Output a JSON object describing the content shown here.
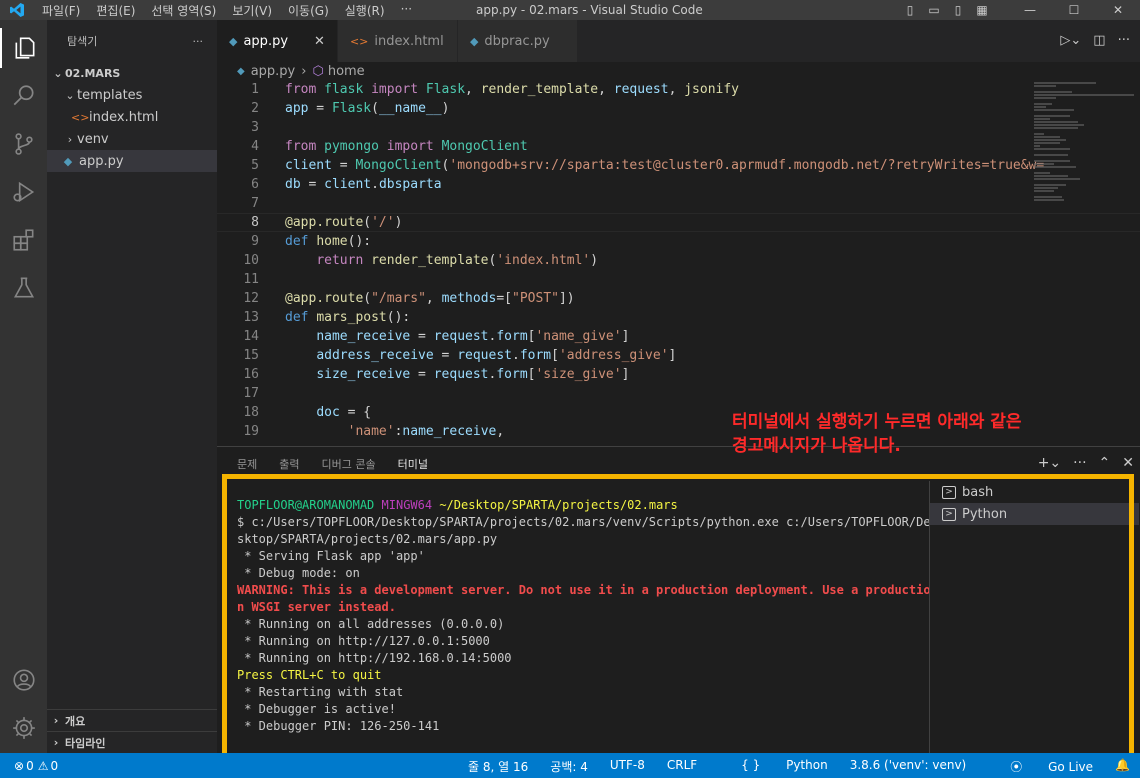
{
  "window": {
    "title": "app.py - 02.mars - Visual Studio Code",
    "menu": [
      "파일(F)",
      "편집(E)",
      "선택 영역(S)",
      "보기(V)",
      "이동(G)",
      "실행(R)",
      "···"
    ]
  },
  "sidebar": {
    "title": "탐색기",
    "more": "···",
    "root": "02.MARS",
    "items": [
      {
        "label": "templates",
        "icon": "chevron-down-icon"
      },
      {
        "label": "index.html",
        "icon": "html-file-icon"
      },
      {
        "label": "venv",
        "icon": "chevron-right-icon"
      },
      {
        "label": "app.py",
        "icon": "python-file-icon"
      }
    ],
    "outline": "개요",
    "timeline": "타임라인"
  },
  "tabs": [
    {
      "label": "app.py",
      "close": "✕"
    },
    {
      "label": "index.html"
    },
    {
      "label": "dbprac.py"
    }
  ],
  "breadcrumb": {
    "file": "app.py",
    "symbol": "home"
  },
  "editor": {
    "line_numbers": [
      "1",
      "2",
      "3",
      "4",
      "5",
      "6",
      "7",
      "8",
      "9",
      "10",
      "11",
      "12",
      "13",
      "14",
      "15",
      "16",
      "17",
      "18",
      "19"
    ],
    "current_line": 8
  },
  "panel": {
    "tabs": [
      "문제",
      "출력",
      "디버그 콘솔",
      "터미널"
    ],
    "active_tab": "터미널",
    "terminal": {
      "prompt_user": "TOPFLOOR@AROMANOMAD",
      "prompt_env": "MINGW64",
      "prompt_path": "~/Desktop/SPARTA/projects/02.mars",
      "cmd1": "$ c:/Users/TOPFLOOR/Desktop/SPARTA/projects/02.mars/venv/Scripts/python.exe c:/Users/TOPFLOOR/De",
      "cmd2": "sktop/SPARTA/projects/02.mars/app.py",
      "l1": " * Serving Flask app 'app'",
      "l2": " * Debug mode: on",
      "warn1": "WARNING: This is a development server. Do not use it in a production deployment. Use a productio",
      "warn2": "n WSGI server instead.",
      "l3": " * Running on all addresses (0.0.0.0)",
      "l4": " * Running on http://127.0.0.1:5000",
      "l5": " * Running on http://192.168.0.14:5000",
      "quit": "Press CTRL+C to quit",
      "l6": " * Restarting with stat",
      "l7": " * Debugger is active!",
      "l8": " * Debugger PIN: 126-250-141"
    },
    "terminals": [
      {
        "label": "bash"
      },
      {
        "label": "Python"
      }
    ]
  },
  "annotation": {
    "line1": "터미널에서 실행하기 누르면 아래와 같은",
    "line2": "경고메시지가 나옵니다."
  },
  "statusbar": {
    "errors": "0",
    "warnings": "0",
    "position": "줄 8, 열 16",
    "spaces": "공백: 4",
    "encoding": "UTF-8",
    "eol": "CRLF",
    "language": "Python",
    "interpreter": "3.8.6 ('venv': venv)",
    "golive": "Go Live"
  },
  "colors": {
    "accent": "#007acc",
    "highlight_border": "#f5b400",
    "annotation": "#ff2a2a"
  }
}
